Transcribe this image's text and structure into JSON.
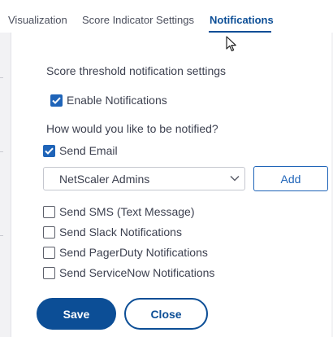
{
  "tabs": [
    {
      "label": "Visualization",
      "active": false
    },
    {
      "label": "Score Indicator Settings",
      "active": false
    },
    {
      "label": "Notifications",
      "active": true
    }
  ],
  "form": {
    "heading": "Score threshold notification settings",
    "enable_notifications": {
      "label": "Enable Notifications",
      "checked": true
    },
    "question": "How would you like to be notified?",
    "send_email": {
      "label": "Send Email",
      "checked": true
    },
    "recipient_select": {
      "value": "NetScaler Admins"
    },
    "add_label": "Add",
    "channels": [
      {
        "label": "Send SMS (Text Message)",
        "checked": false
      },
      {
        "label": "Send Slack Notifications",
        "checked": false
      },
      {
        "label": "Send PagerDuty Notifications",
        "checked": false
      },
      {
        "label": "Send ServiceNow Notifications",
        "checked": false
      }
    ]
  },
  "actions": {
    "save_label": "Save",
    "close_label": "Close"
  },
  "colors": {
    "accent": "#0c4e96",
    "checkbox_checked": "#1f64b8",
    "text": "#3d4150",
    "page_background": "#f2f2f4"
  }
}
